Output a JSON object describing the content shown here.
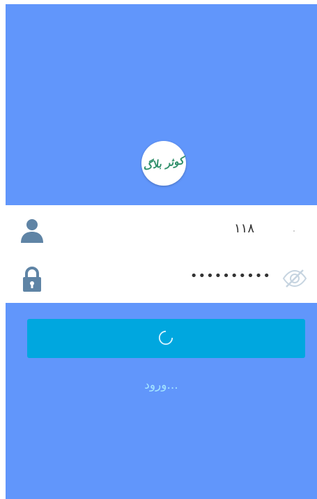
{
  "logo": {
    "text": "کوثر بلاگ"
  },
  "form": {
    "username": {
      "value": "۱۱۸",
      "icon": "user-icon"
    },
    "password": {
      "value": "••••••••••",
      "icon": "lock-icon",
      "toggle_icon": "eye-slash-icon"
    }
  },
  "login": {
    "status_text": "ورود...",
    "spinner_icon": "spinner-icon"
  },
  "colors": {
    "background": "#6196fb",
    "button": "#00a7df",
    "icon": "#5f84a5",
    "status_text": "#a4e5ff"
  }
}
